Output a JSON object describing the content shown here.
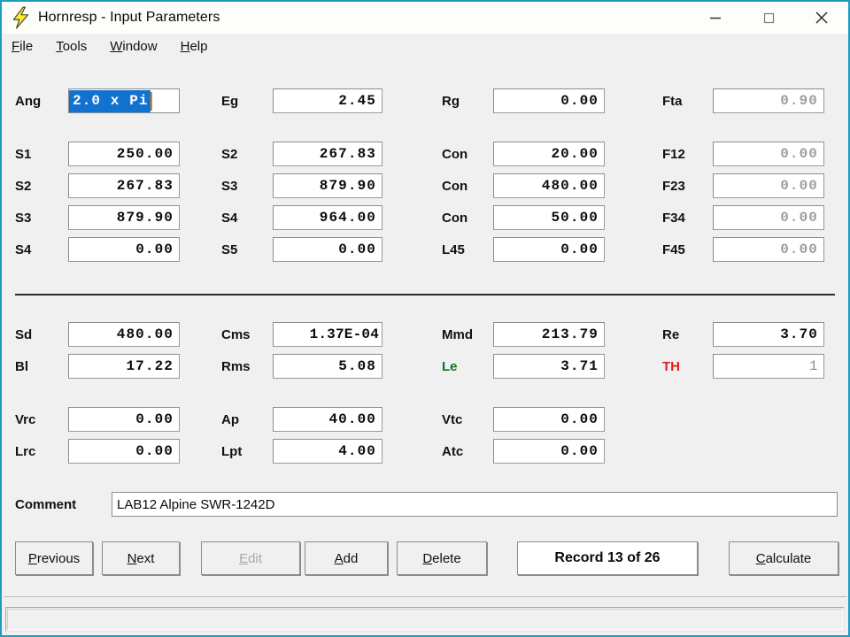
{
  "window": {
    "title": "Hornresp - Input Parameters",
    "icon": "lightning-bolt-icon",
    "border_color": "#1d9cbe",
    "minimize_label": "—",
    "maximize_label": "□",
    "close_label": "✕"
  },
  "menubar": {
    "items": [
      {
        "label": "File",
        "accel": "F"
      },
      {
        "label": "Tools",
        "accel": "T"
      },
      {
        "label": "Window",
        "accel": "W"
      },
      {
        "label": "Help",
        "accel": "H"
      }
    ]
  },
  "colors": {
    "selection": "#1272d0",
    "caret": "#e08020",
    "label_green": "#07771f",
    "label_red": "#e01d1d",
    "disabled_text": "#9d9d9d",
    "face": "#f0f0f0"
  },
  "fields": {
    "row1": [
      {
        "label": "Ang",
        "value": "2.0 x Pi",
        "state": "selected"
      },
      {
        "label": "Eg",
        "value": "2.45",
        "state": "normal"
      },
      {
        "label": "Rg",
        "value": "0.00",
        "state": "normal"
      },
      {
        "label": "Fta",
        "value": "0.90",
        "state": "disabled"
      }
    ],
    "row2": [
      {
        "label": "S1",
        "value": "250.00",
        "state": "normal"
      },
      {
        "label": "S2",
        "value": "267.83",
        "state": "normal"
      },
      {
        "label": "Con",
        "value": "20.00",
        "state": "normal"
      },
      {
        "label": "F12",
        "value": "0.00",
        "state": "disabled"
      }
    ],
    "row3": [
      {
        "label": "S2",
        "value": "267.83",
        "state": "normal"
      },
      {
        "label": "S3",
        "value": "879.90",
        "state": "normal"
      },
      {
        "label": "Con",
        "value": "480.00",
        "state": "normal"
      },
      {
        "label": "F23",
        "value": "0.00",
        "state": "disabled"
      }
    ],
    "row4": [
      {
        "label": "S3",
        "value": "879.90",
        "state": "normal"
      },
      {
        "label": "S4",
        "value": "964.00",
        "state": "normal"
      },
      {
        "label": "Con",
        "value": "50.00",
        "state": "normal"
      },
      {
        "label": "F34",
        "value": "0.00",
        "state": "disabled"
      }
    ],
    "row5": [
      {
        "label": "S4",
        "value": "0.00",
        "state": "normal"
      },
      {
        "label": "S5",
        "value": "0.00",
        "state": "normal"
      },
      {
        "label": "L45",
        "value": "0.00",
        "state": "normal"
      },
      {
        "label": "F45",
        "value": "0.00",
        "state": "disabled"
      }
    ],
    "row6": [
      {
        "label": "Sd",
        "value": "480.00",
        "state": "normal"
      },
      {
        "label": "Cms",
        "value": "1.37E-04",
        "state": "normal"
      },
      {
        "label": "Mmd",
        "value": "213.79",
        "state": "normal"
      },
      {
        "label": "Re",
        "value": "3.70",
        "state": "normal"
      }
    ],
    "row7": [
      {
        "label": "Bl",
        "value": "17.22",
        "state": "normal"
      },
      {
        "label": "Rms",
        "value": "5.08",
        "state": "normal"
      },
      {
        "label": "Le",
        "value": "3.71",
        "state": "normal",
        "label_color": "green"
      },
      {
        "label": "TH",
        "value": "1",
        "state": "greyval",
        "label_color": "red"
      }
    ],
    "row8": [
      {
        "label": "Vrc",
        "value": "0.00",
        "state": "normal"
      },
      {
        "label": "Ap",
        "value": "40.00",
        "state": "normal"
      },
      {
        "label": "Vtc",
        "value": "0.00",
        "state": "normal"
      }
    ],
    "row9": [
      {
        "label": "Lrc",
        "value": "0.00",
        "state": "normal"
      },
      {
        "label": "Lpt",
        "value": "4.00",
        "state": "normal"
      },
      {
        "label": "Atc",
        "value": "0.00",
        "state": "normal"
      }
    ]
  },
  "comment": {
    "label": "Comment",
    "value": "LAB12 Alpine SWR-1242D"
  },
  "buttons": {
    "previous": {
      "label": "Previous",
      "accel": "P",
      "enabled": true
    },
    "next": {
      "label": "Next",
      "accel": "N",
      "enabled": true
    },
    "edit": {
      "label": "Edit",
      "accel": "E",
      "enabled": false
    },
    "add": {
      "label": "Add",
      "accel": "A",
      "enabled": true
    },
    "delete": {
      "label": "Delete",
      "accel": "D",
      "enabled": true
    },
    "calculate": {
      "label": "Calculate",
      "accel": "C",
      "enabled": true
    }
  },
  "record": {
    "text": "Record 13 of 26",
    "current": 13,
    "total": 26
  },
  "statusbar": {
    "text": ""
  }
}
